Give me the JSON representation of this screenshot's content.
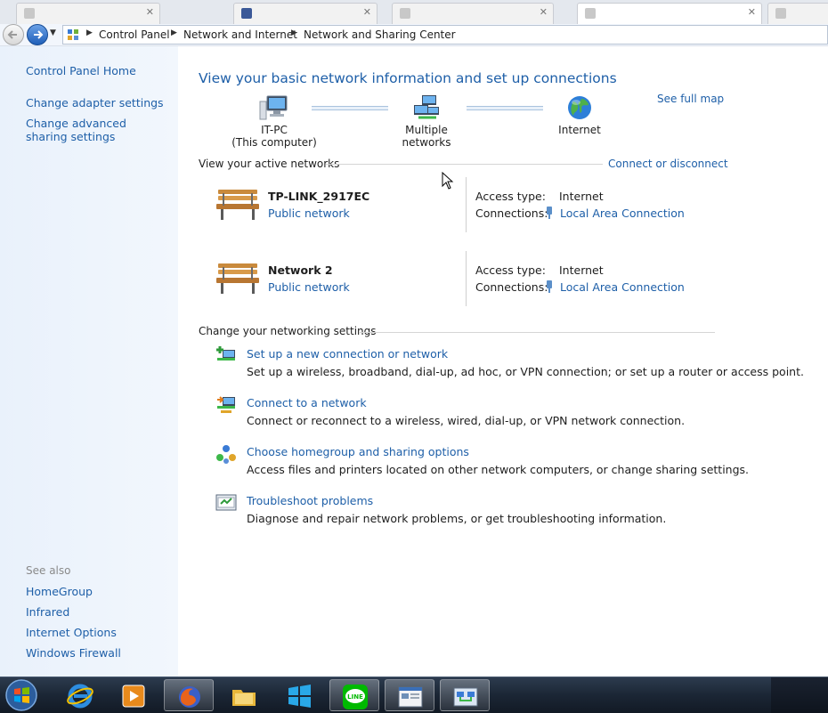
{
  "address": {
    "crumbs": [
      "Control Panel",
      "Network and Internet",
      "Network and Sharing Center"
    ]
  },
  "left_pane": {
    "links": [
      "Control Panel Home",
      "Change adapter settings",
      "Change advanced sharing settings"
    ],
    "see_also_label": "See also",
    "see_also": [
      "HomeGroup",
      "Infrared",
      "Internet Options",
      "Windows Firewall"
    ]
  },
  "main": {
    "title": "View your basic network information and set up connections",
    "see_full_map": "See full map",
    "map": {
      "computer_name": "IT-PC",
      "computer_note": "(This computer)",
      "middle": "Multiple networks",
      "internet": "Internet"
    },
    "active_networks_label": "View your active networks",
    "connect_disconnect": "Connect or disconnect",
    "networks": [
      {
        "name": "TP-LINK_2917EC",
        "type": "Public network",
        "access_label": "Access type:",
        "access": "Internet",
        "conn_label": "Connections:",
        "connection": "Local Area Connection"
      },
      {
        "name": "Network  2",
        "type": "Public network",
        "access_label": "Access type:",
        "access": "Internet",
        "conn_label": "Connections:",
        "connection": "Local Area Connection"
      }
    ],
    "settings_label": "Change your networking settings",
    "tasks": [
      {
        "title": "Set up a new connection or network",
        "desc": "Set up a wireless, broadband, dial-up, ad hoc, or VPN connection; or set up a router or access point.",
        "icon": "new-connection-icon"
      },
      {
        "title": "Connect to a network",
        "desc": "Connect or reconnect to a wireless, wired, dial-up, or VPN network connection.",
        "icon": "connect-network-icon"
      },
      {
        "title": "Choose homegroup and sharing options",
        "desc": "Access files and printers located on other network computers, or change sharing settings.",
        "icon": "homegroup-icon"
      },
      {
        "title": "Troubleshoot problems",
        "desc": "Diagnose and repair network problems, or get troubleshooting information.",
        "icon": "troubleshoot-icon"
      }
    ]
  },
  "taskbar": {
    "items": [
      "start-orb",
      "internet-explorer-icon",
      "media-player-icon",
      "firefox-icon",
      "file-explorer-icon",
      "windows-store-icon",
      "line-app-icon",
      "window-app-icon",
      "network-control-panel-icon"
    ]
  },
  "colors": {
    "link": "#1e5fa8",
    "left_pane_bg": "#eaf1fb",
    "taskbar_bg": "#1b2635",
    "line_green": "#00b900"
  }
}
